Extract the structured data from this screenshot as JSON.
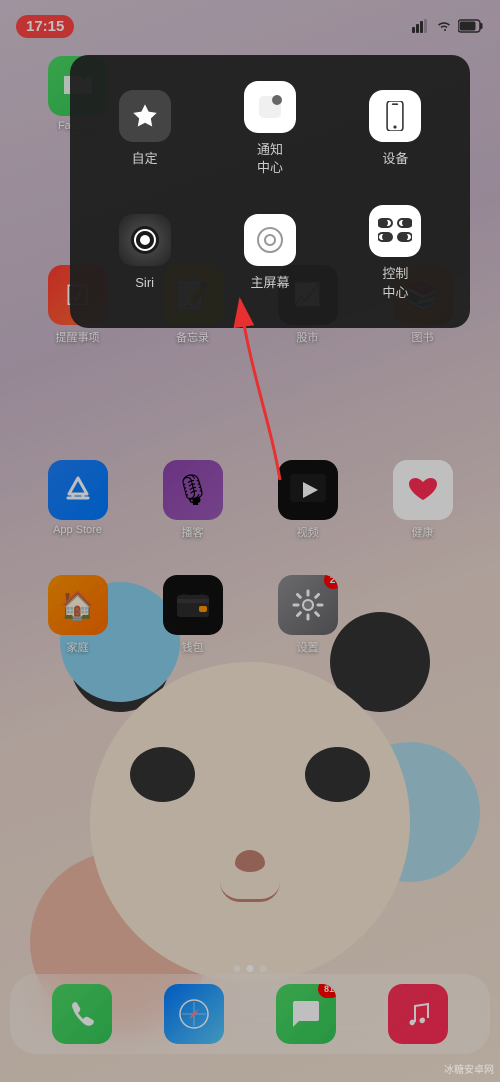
{
  "statusBar": {
    "time": "17:15",
    "signalIcon": "📶",
    "wifiIcon": "WiFi",
    "batteryIcon": "🔋"
  },
  "contextMenu": {
    "items": [
      {
        "id": "notification-center",
        "label": "通知\n中心",
        "icon": "notif"
      },
      {
        "id": "spacer",
        "label": "",
        "icon": ""
      },
      {
        "id": "device",
        "label": "设备",
        "icon": "device"
      },
      {
        "id": "customize",
        "label": "自定",
        "icon": "star"
      },
      {
        "id": "spacer2",
        "label": "",
        "icon": ""
      },
      {
        "id": "control-toggle",
        "label": "控制\n中心",
        "icon": "toggles"
      },
      {
        "id": "siri",
        "label": "Siri",
        "icon": "siri"
      },
      {
        "id": "home-screen",
        "label": "主屏幕",
        "icon": "home"
      },
      {
        "id": "spacer3",
        "label": "",
        "icon": ""
      }
    ]
  },
  "appRows": {
    "row1": [
      {
        "id": "facetime",
        "label": "FaceTime",
        "class": "app-facetime"
      },
      {
        "id": "blank1",
        "label": "",
        "class": ""
      },
      {
        "id": "blank2",
        "label": "",
        "class": ""
      },
      {
        "id": "blank3",
        "label": "",
        "class": ""
      }
    ],
    "row2": [
      {
        "id": "mail",
        "label": "",
        "class": "app-mail"
      },
      {
        "id": "blank4",
        "label": "",
        "class": ""
      },
      {
        "id": "blank5",
        "label": "",
        "class": ""
      },
      {
        "id": "icloud",
        "label": "",
        "class": "app-icloud"
      }
    ],
    "shortcuts": [
      {
        "id": "reminders",
        "label": "提醒事项",
        "class": "app-reminders"
      },
      {
        "id": "notes",
        "label": "备忘录",
        "class": "app-notes"
      },
      {
        "id": "appstore-s",
        "label": "股市",
        "class": "app-photos"
      },
      {
        "id": "books",
        "label": "图书",
        "class": "app-books"
      }
    ],
    "row3": [
      {
        "id": "appstore",
        "label": "App Store",
        "class": "app-appstore"
      },
      {
        "id": "podcasts",
        "label": "播客",
        "class": "app-podcasts"
      },
      {
        "id": "tv",
        "label": "视频",
        "class": "app-tv"
      },
      {
        "id": "health",
        "label": "健康",
        "class": "app-health"
      }
    ],
    "row4": [
      {
        "id": "home",
        "label": "家庭",
        "class": "app-home"
      },
      {
        "id": "wallet",
        "label": "钱包",
        "class": "app-wallet"
      },
      {
        "id": "settings",
        "label": "设置",
        "class": "app-settings",
        "badge": "2"
      },
      {
        "id": "blank6",
        "label": "",
        "class": ""
      }
    ]
  },
  "dock": [
    {
      "id": "phone",
      "class": "app-phone",
      "icon": "📞"
    },
    {
      "id": "safari",
      "class": "app-safari",
      "icon": "🧭"
    },
    {
      "id": "messages",
      "class": "app-messages",
      "icon": "💬",
      "badge": "81"
    },
    {
      "id": "music",
      "class": "app-music",
      "icon": "🎵"
    }
  ],
  "pageIndicator": {
    "dots": [
      false,
      true,
      false
    ]
  },
  "watermark": "冰糖安卓网",
  "arrow": {
    "color": "#e83030"
  }
}
